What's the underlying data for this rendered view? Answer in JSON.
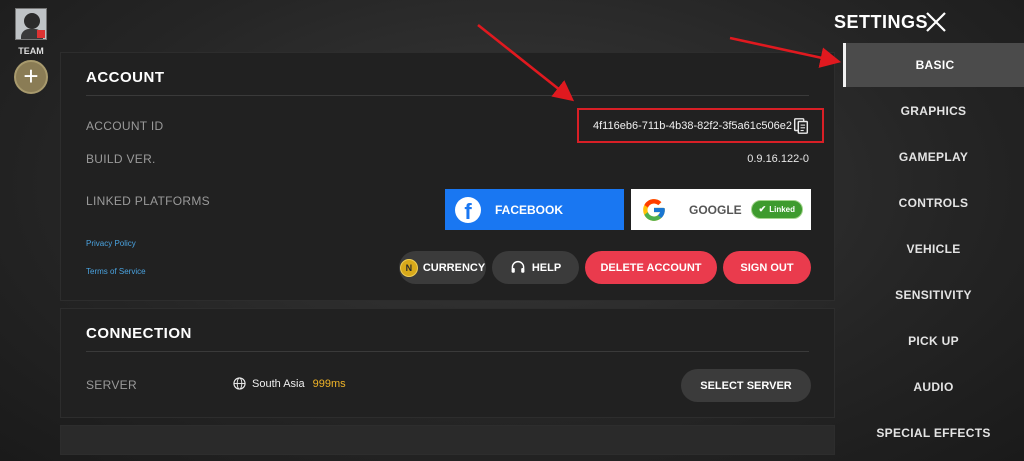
{
  "left_bar": {
    "team_label": "TEAM",
    "add_label": "+"
  },
  "account": {
    "title": "ACCOUNT",
    "account_id_label": "ACCOUNT ID",
    "account_id_value": "4f116eb6-711b-4b38-82f2-3f5a61c506e2",
    "build_label": "BUILD VER.",
    "build_value": "0.9.16.122-0",
    "linked_platforms_label": "LINKED PLATFORMS",
    "privacy_policy": "Privacy Policy",
    "terms_of_service": "Terms of Service",
    "facebook_label": "FACEBOOK",
    "google_label": "GOOGLE",
    "linked_badge": "Linked",
    "currency_label": "CURRENCY",
    "currency_coin": "N",
    "help_label": "HELP",
    "delete_label": "DELETE ACCOUNT",
    "signout_label": "SIGN OUT"
  },
  "connection": {
    "title": "CONNECTION",
    "server_label": "SERVER",
    "server_region": "South Asia",
    "ping": "999ms",
    "select_server_label": "SELECT SERVER"
  },
  "settings": {
    "title": "SETTINGS",
    "menu": [
      {
        "label": "BASIC",
        "active": true
      },
      {
        "label": "GRAPHICS"
      },
      {
        "label": "GAMEPLAY"
      },
      {
        "label": "CONTROLS"
      },
      {
        "label": "VEHICLE"
      },
      {
        "label": "SENSITIVITY"
      },
      {
        "label": "PICK UP"
      },
      {
        "label": "AUDIO"
      },
      {
        "label": "SPECIAL EFFECTS"
      }
    ]
  },
  "colors": {
    "accent_red": "#ea3b4d",
    "facebook_blue": "#1977f2",
    "annotation_red": "#d91f26",
    "ping_yellow": "#f0b428",
    "linked_green": "#3e9b2e"
  }
}
